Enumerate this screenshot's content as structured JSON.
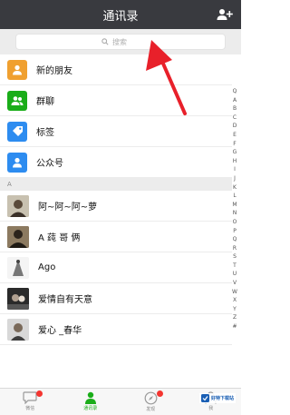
{
  "header": {
    "title": "通讯录"
  },
  "search": {
    "placeholder": "搜索"
  },
  "functions": [
    {
      "label": "新的朋友",
      "color": "#f0a030",
      "icon": "new-friend-icon"
    },
    {
      "label": "群聊",
      "color": "#1aad19",
      "icon": "group-chat-icon"
    },
    {
      "label": "标签",
      "color": "#2d8cf0",
      "icon": "tag-icon"
    },
    {
      "label": "公众号",
      "color": "#2d8cf0",
      "icon": "official-account-icon"
    }
  ],
  "section": {
    "letter": "A"
  },
  "contacts": [
    {
      "name": "阿~阿~阿~萝"
    },
    {
      "name": "A 莼 哥 俩"
    },
    {
      "name": "Ago"
    },
    {
      "name": "爱情自有天意"
    },
    {
      "name": "爱心 _春华"
    }
  ],
  "index_letters": [
    "Q",
    "A",
    "B",
    "C",
    "D",
    "E",
    "F",
    "G",
    "H",
    "I",
    "J",
    "K",
    "L",
    "M",
    "N",
    "O",
    "P",
    "Q",
    "R",
    "S",
    "T",
    "U",
    "V",
    "W",
    "X",
    "Y",
    "Z",
    "#"
  ],
  "tabs": [
    {
      "label": "微信",
      "active": false,
      "badge": true
    },
    {
      "label": "通讯录",
      "active": true,
      "badge": false
    },
    {
      "label": "发现",
      "active": false,
      "badge": true
    },
    {
      "label": "我",
      "active": false,
      "badge": false
    }
  ],
  "watermark": {
    "text": "好特下载站"
  },
  "colors": {
    "header_bg": "#393a3f",
    "accent_green": "#1aad19",
    "annotation_red": "#e8202a"
  }
}
